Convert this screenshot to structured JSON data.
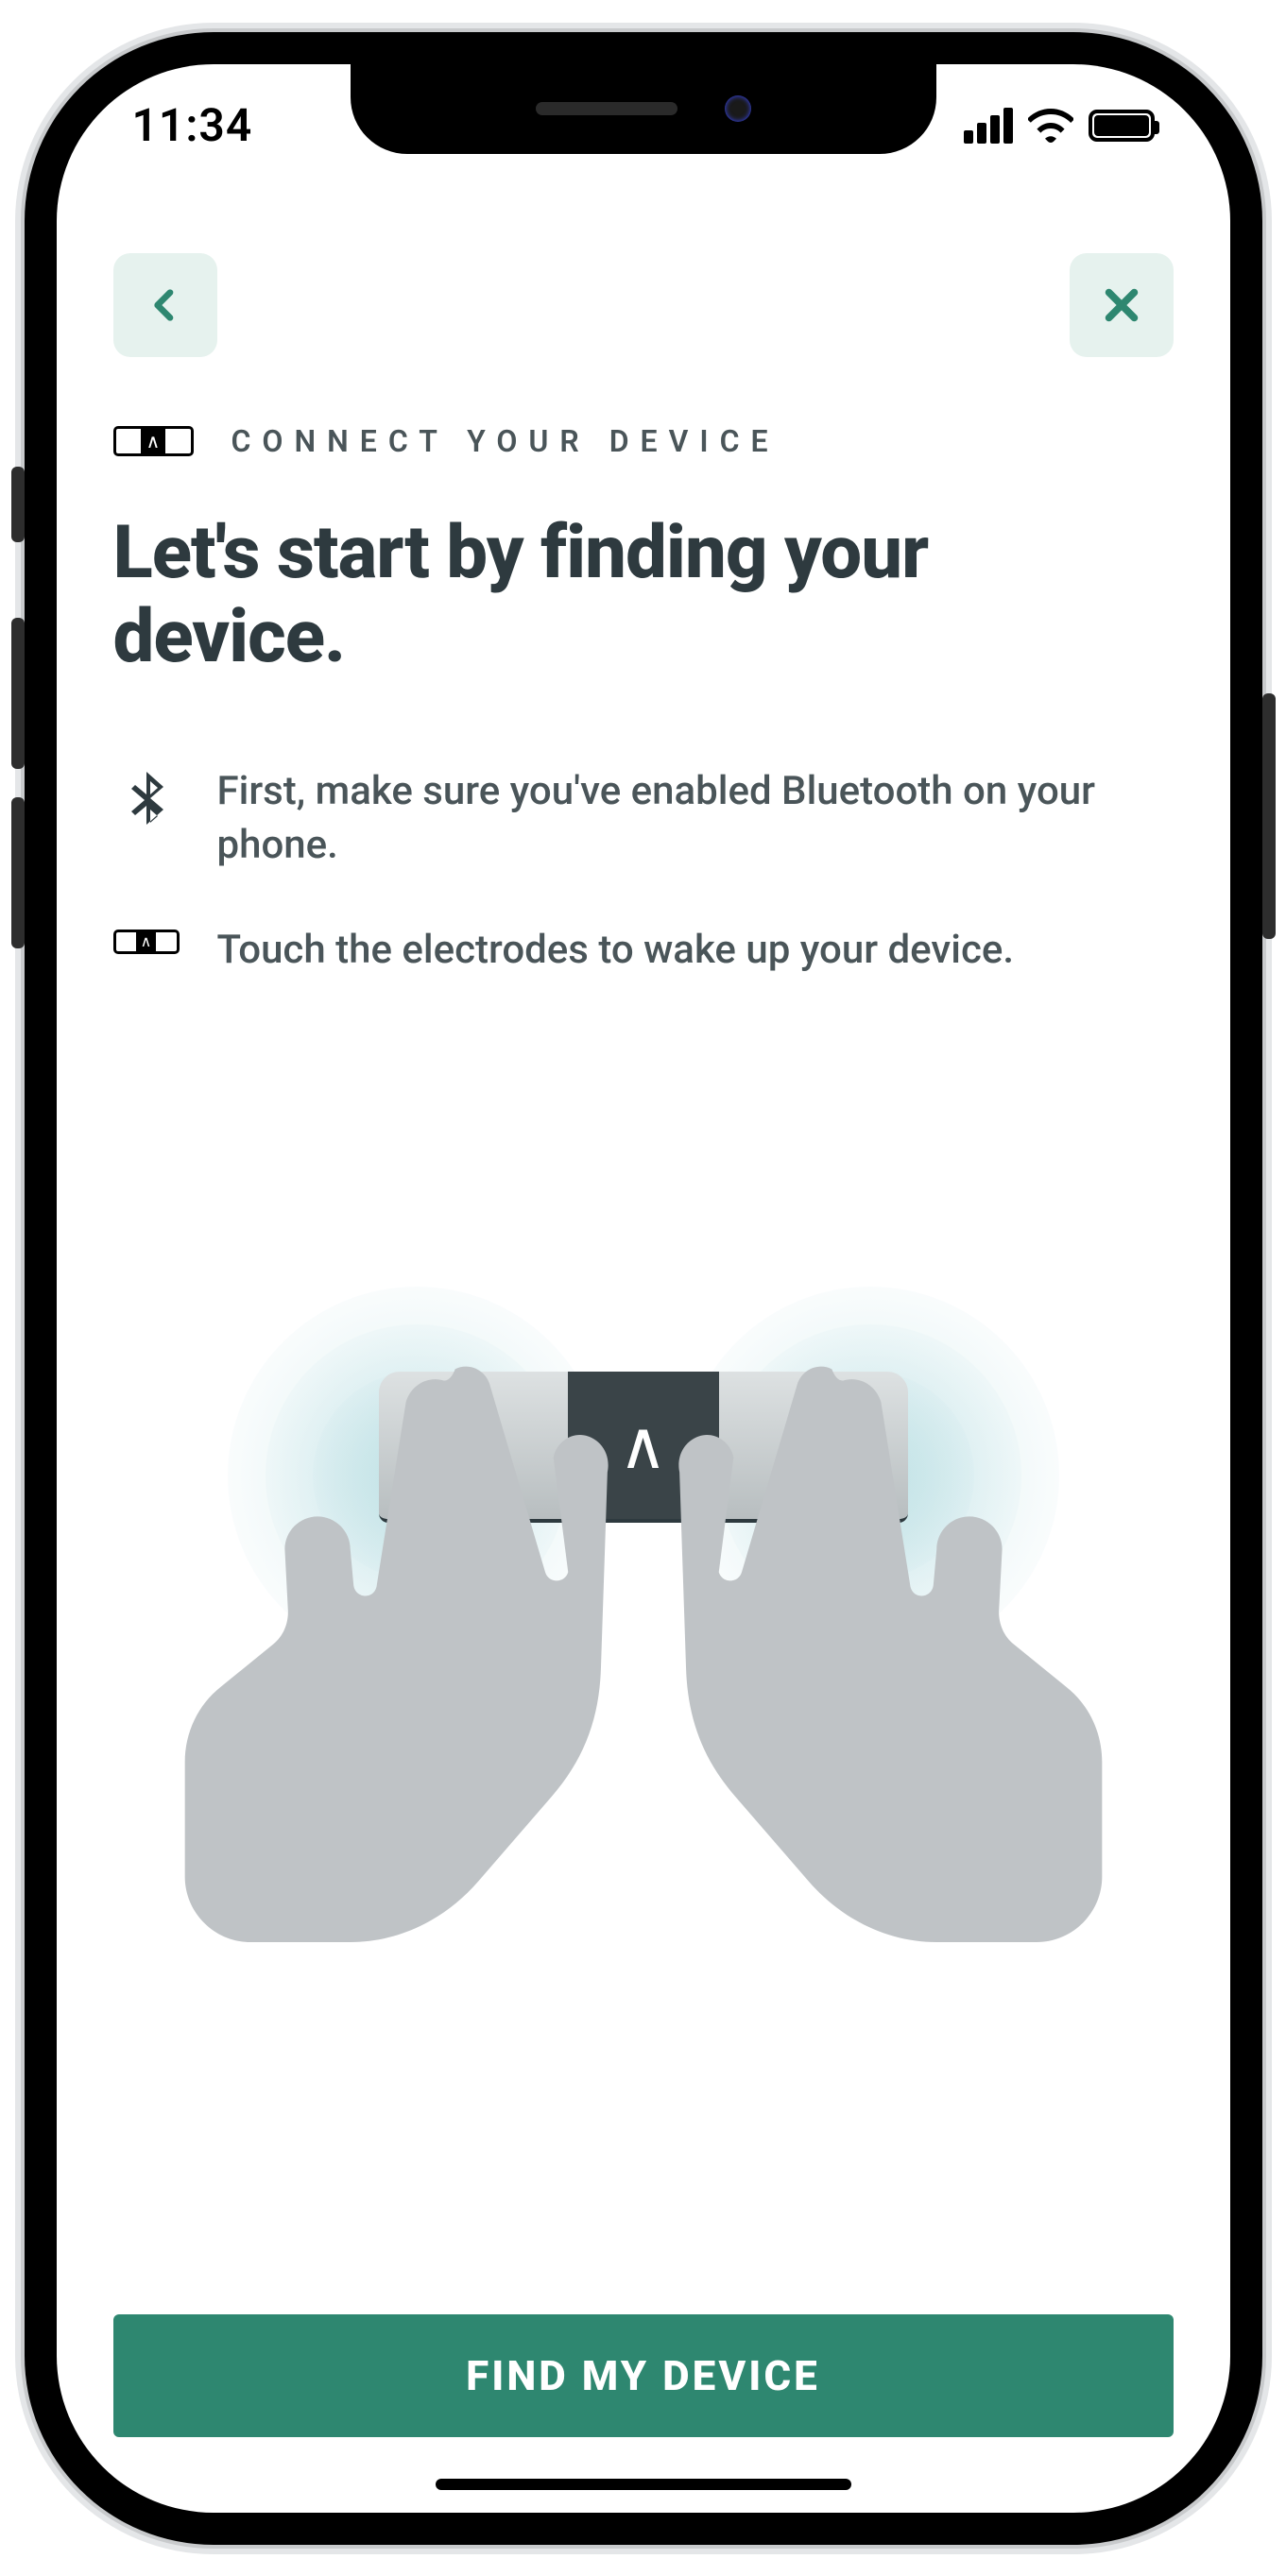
{
  "status": {
    "time": "11:34"
  },
  "nav": {
    "back_aria": "Back",
    "close_aria": "Close"
  },
  "eyebrow": "CONNECT YOUR DEVICE",
  "title": "Let's start by finding your device.",
  "steps": [
    {
      "icon": "bluetooth",
      "text": "First, make sure you've enabled Bluetooth on your phone."
    },
    {
      "icon": "device",
      "text": "Touch the electrodes to wake up your device."
    }
  ],
  "cta_label": "FIND MY DEVICE"
}
